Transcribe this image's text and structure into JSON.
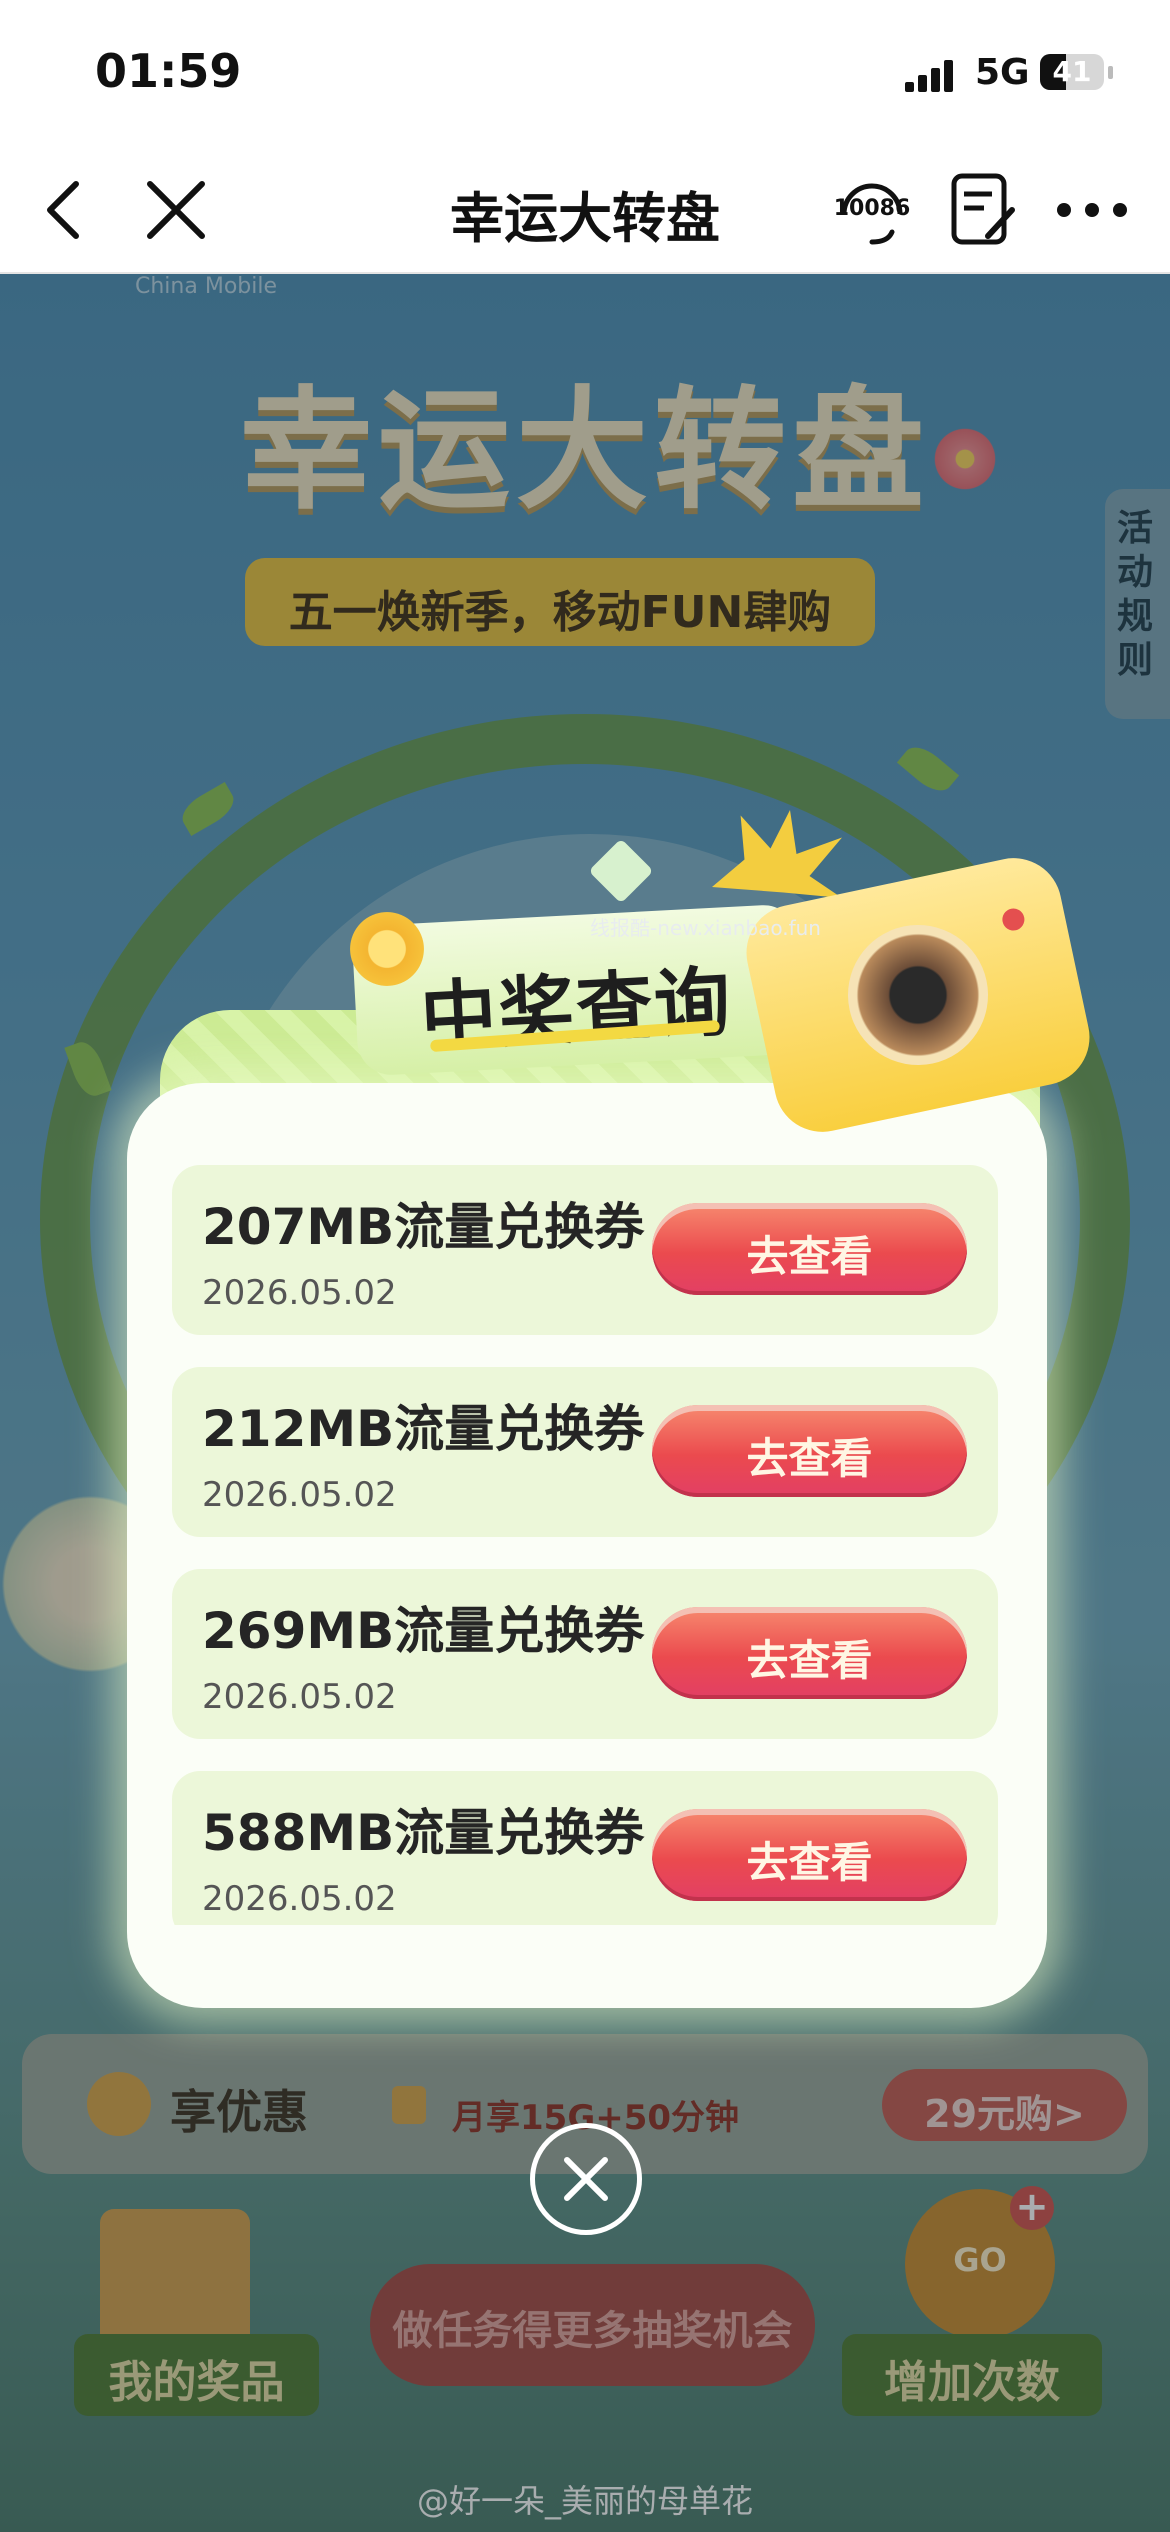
{
  "status_bar": {
    "time": "01:59",
    "network": "5G",
    "battery": "41"
  },
  "nav": {
    "title": "幸运大转盘",
    "service_number": "10086"
  },
  "background": {
    "brand": "China Mobile",
    "banner_title": "幸运大转盘",
    "slogan": "五一焕新季，移动FUN肆购",
    "rules_tab": "活动规则",
    "promo": {
      "label": "享优惠",
      "description": "月享15G+50分钟",
      "button": "29元购>"
    },
    "my_prizes": "我的奖品",
    "task_button": "做任务得更多抽奖机会",
    "add_chances": "增加次数",
    "wheel_go": "GO"
  },
  "dialog": {
    "title": "中奖查询",
    "source_watermark": "线报酷-new.xianbao.fun",
    "items": [
      {
        "name": "207MB流量兑换券",
        "date": "2026.05.02",
        "action": "去查看"
      },
      {
        "name": "212MB流量兑换券",
        "date": "2026.05.02",
        "action": "去查看"
      },
      {
        "name": "269MB流量兑换券",
        "date": "2026.05.02",
        "action": "去查看"
      },
      {
        "name": "588MB流量兑换券",
        "date": "2026.05.02",
        "action": "去查看"
      }
    ]
  },
  "watermark": "@好一朵_美丽的母单花",
  "colors": {
    "accent_red": "#eb4a4e",
    "card_bg": "#ecf7d9",
    "banner_gold": "#e9c23e"
  }
}
